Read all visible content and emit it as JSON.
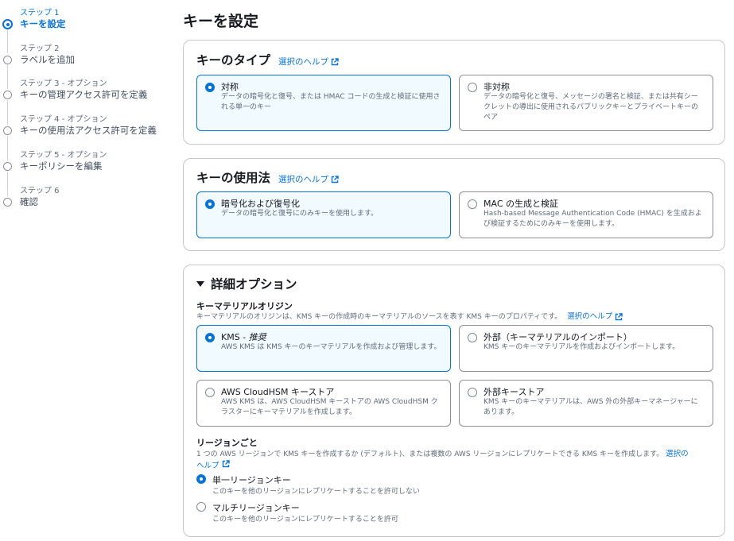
{
  "steps": [
    {
      "num": "ステップ 1",
      "title": "キーを設定"
    },
    {
      "num": "ステップ 2",
      "title": "ラベルを追加"
    },
    {
      "num": "ステップ 3 - オプション",
      "title": "キーの管理アクセス許可を定義"
    },
    {
      "num": "ステップ 4 - オプション",
      "title": "キーの使用法アクセス許可を定義"
    },
    {
      "num": "ステップ 5 - オプション",
      "title": "キーポリシーを編集"
    },
    {
      "num": "ステップ 6",
      "title": "確認"
    }
  ],
  "page_title": "キーを設定",
  "help_label": "選択のヘルプ",
  "key_type": {
    "heading": "キーのタイプ",
    "options": [
      {
        "label": "対称",
        "desc": "データの暗号化と復号、または HMAC コードの生成と検証に使用される単一のキー"
      },
      {
        "label": "非対称",
        "desc": "データの暗号化と復号、メッセージの署名と検証、または共有シークレットの導出に使用されるパブリックキーとプライベートキーのペア"
      }
    ]
  },
  "key_usage": {
    "heading": "キーの使用法",
    "options": [
      {
        "label": "暗号化および復号化",
        "desc": "データの暗号化と復号にのみキーを使用します。"
      },
      {
        "label": "MAC の生成と検証",
        "desc": "Hash-based Message Authentication Code (HMAC) を生成および検証するためにのみキーを使用します。"
      }
    ]
  },
  "advanced": {
    "heading": "詳細オプション",
    "origin_heading": "キーマテリアルオリジン",
    "origin_desc": "キーマテリアルのオリジンは、KMS キーの作成時のキーマテリアルのソースを表す KMS キーのプロパティです。",
    "origin_options": [
      {
        "label": "KMS - ",
        "label_em": "推奨",
        "desc": "AWS KMS は KMS キーのキーマテリアルを作成および管理します。"
      },
      {
        "label": "外部（キーマテリアルのインポート）",
        "desc": "KMS キーのキーマテリアルを作成およびインポートします。"
      },
      {
        "label": "AWS CloudHSM キーストア",
        "desc": "AWS KMS は、AWS CloudHSM キーストアの AWS CloudHSM クラスターにキーマテリアルを作成します。"
      },
      {
        "label": "外部キーストア",
        "desc": "KMS キーのキーマテリアルは、AWS 外の外部キーマネージャーにあります。"
      }
    ],
    "region_heading": "リージョンごと",
    "region_desc": "1 つの AWS リージョンで KMS キーを作成するか (デフォルト)、または複数の AWS リージョンにレプリケートできる KMS キーを作成します。",
    "region_help_a": "選択の",
    "region_help_b": "ヘルプ",
    "region_options": [
      {
        "label": "単一リージョンキー",
        "desc": "このキーを他のリージョンにレプリケートすることを許可しない"
      },
      {
        "label": "マルチリージョンキー",
        "desc": "このキーを他のリージョンにレプリケートすることを許可"
      }
    ]
  },
  "colors": {
    "accent": "#0972d3",
    "selected_bg": "#f1faff",
    "border": "#c6c6cd"
  }
}
